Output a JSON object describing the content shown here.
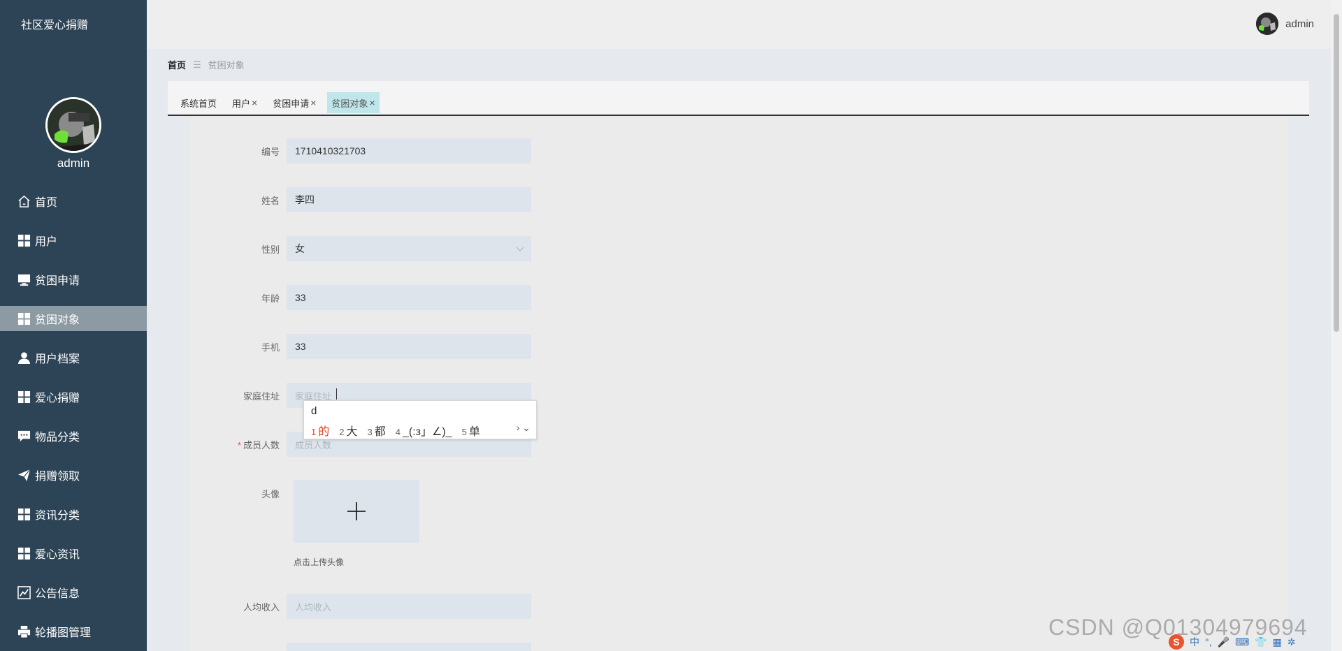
{
  "app": {
    "brand": "社区爱心捐赠"
  },
  "sidebar": {
    "username": "admin",
    "items": [
      {
        "label": "首页",
        "icon": "home-icon"
      },
      {
        "label": "用户",
        "icon": "grid-icon"
      },
      {
        "label": "贫困申请",
        "icon": "monitor-icon"
      },
      {
        "label": "贫困对象",
        "icon": "grid-icon",
        "active": true
      },
      {
        "label": "用户档案",
        "icon": "user-icon"
      },
      {
        "label": "爱心捐赠",
        "icon": "grid-icon"
      },
      {
        "label": "物品分类",
        "icon": "chat-icon"
      },
      {
        "label": "捐赠领取",
        "icon": "send-icon"
      },
      {
        "label": "资讯分类",
        "icon": "grid-icon"
      },
      {
        "label": "爱心资讯",
        "icon": "grid-icon"
      },
      {
        "label": "公告信息",
        "icon": "chart-icon"
      },
      {
        "label": "轮播图管理",
        "icon": "print-icon"
      }
    ]
  },
  "header": {
    "username": "admin"
  },
  "breadcrumb": {
    "home": "首页",
    "separator": "☰",
    "current": "贫困对象"
  },
  "tabs": [
    {
      "label": "系统首页",
      "closable": false
    },
    {
      "label": "用户",
      "closable": true
    },
    {
      "label": "贫困申请",
      "closable": true
    },
    {
      "label": "贫困对象",
      "closable": true,
      "active": true
    }
  ],
  "form": {
    "number": {
      "label": "编号",
      "value": "1710410321703"
    },
    "name": {
      "label": "姓名",
      "value": "李四"
    },
    "gender": {
      "label": "性别",
      "value": "女"
    },
    "age": {
      "label": "年龄",
      "value": "33"
    },
    "phone": {
      "label": "手机",
      "value": "33"
    },
    "address": {
      "label": "家庭住址",
      "placeholder": "家庭住址"
    },
    "members": {
      "label": "成员人数",
      "placeholder": "成员人数",
      "required": true
    },
    "avatar": {
      "label": "头像",
      "hint": "点击上传头像"
    },
    "income": {
      "label": "人均收入",
      "placeholder": "人均收入"
    }
  },
  "ime": {
    "input": "d",
    "candidates": [
      {
        "n": "1",
        "text": "的"
      },
      {
        "n": "2",
        "text": "大"
      },
      {
        "n": "3",
        "text": "都"
      },
      {
        "n": "4",
        "text": "_(:з」∠)_"
      },
      {
        "n": "5",
        "text": "单"
      }
    ],
    "nav": "› ⌄"
  },
  "watermark": "CSDN @Q01304979694",
  "tray": {
    "lang": "中"
  },
  "colors": {
    "sidebar": "#2d4456",
    "active_menu": "#8c9aa3",
    "active_tab": "#bfe6ea",
    "field": "#dde4ec",
    "ime_highlight": "#e0401c"
  }
}
